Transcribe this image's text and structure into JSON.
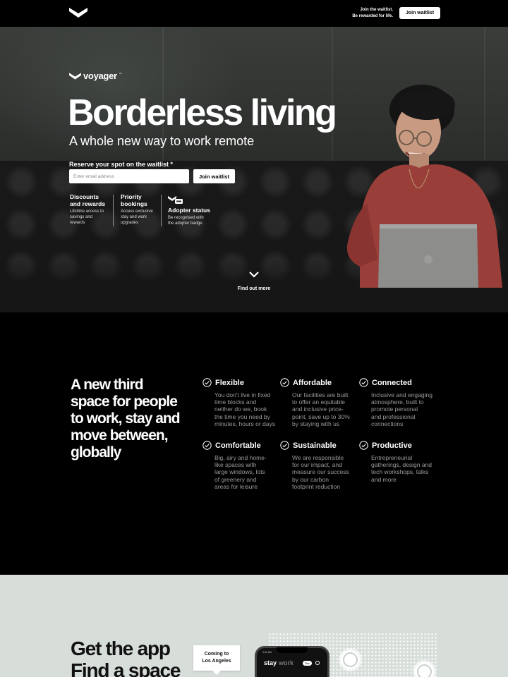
{
  "topbar": {
    "tm": "™",
    "waitlist_line1": "Join the waitlist.",
    "waitlist_line2": "Be rewarded for life.",
    "join_button": "Join waitlist"
  },
  "hero": {
    "brand": "voyager",
    "brand_tm": "™",
    "title": "Borderless living",
    "subtitle": "A whole new way to work remote",
    "reserve_label": "Reserve your spot on the waitlist *",
    "email_placeholder": "Enter email address",
    "join_button": "Join waitlist",
    "perks": [
      {
        "title_line1": "Discounts",
        "title_line2": "and rewards",
        "desc_line1": "Lifetime access to",
        "desc_line2": "savings and",
        "desc_line3": "rewards"
      },
      {
        "title_line1": "Priority",
        "title_line2": "bookings",
        "desc_line1": "Access exclusive",
        "desc_line2": "stay and work",
        "desc_line3": "upgrades"
      },
      {
        "title_line1": "Adopter status",
        "desc_line1": "Be recognised with",
        "desc_line2": "the adopter badge"
      }
    ],
    "find_out_more": "Find out more",
    "chevron_icon": "chevron-down-icon"
  },
  "features": {
    "heading_line1": "A new third",
    "heading_line2": "space for people",
    "heading_line3": "to work, stay and",
    "heading_line4": "move between,",
    "heading_line5": "globally",
    "items": [
      {
        "title": "Flexible",
        "lines": [
          "You don't live in fixed",
          "time blocks and",
          "neither do we, book",
          "the time you need by",
          "minutes, hours or days"
        ]
      },
      {
        "title": "Affordable",
        "lines": [
          "Our facilities are built",
          "to offer an equitable",
          "and inclusive price-",
          "point, save up to 30%",
          "by staying with us"
        ]
      },
      {
        "title": "Connected",
        "lines": [
          "Inclusive and engaging",
          "atmosphere, built to",
          "promote personal",
          "and professional",
          "connections"
        ]
      },
      {
        "title": "Comfortable",
        "lines": [
          "Big, airy and home-",
          "like spaces with",
          "large windows, lots",
          "of greenery and",
          "areas for leisure"
        ]
      },
      {
        "title": "Sustainable",
        "lines": [
          "We are responsible",
          "for our impact, and",
          "measure our success",
          "by our carbon",
          "footprint reduction"
        ]
      },
      {
        "title": "Productive",
        "lines": [
          "Entrepreneurial",
          "gatherings, design and",
          "tech workshops, talks",
          "and more"
        ]
      }
    ]
  },
  "app": {
    "heading_line1": "Get the app",
    "heading_line2": "Find a space",
    "bubble_line1": "Coming to",
    "bubble_line2": "Los Angeles",
    "phone_time": "9:41 AM",
    "tab_stay": "stay",
    "tab_work": "work",
    "tab_badge": "Tier"
  },
  "colors": {
    "background": "#000000",
    "app_section_bg": "#d7ddd9",
    "muted_text": "#9a9a9a"
  }
}
